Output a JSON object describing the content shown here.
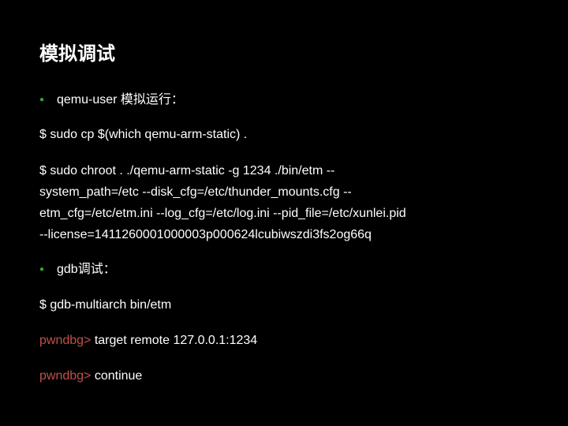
{
  "title": "模拟调试",
  "bullet1": "qemu-user 模拟运行：",
  "line1_prompt": "$",
  "line1_cmd": " sudo cp $(which qemu-arm-static) .",
  "line2_prompt": "$",
  "line2_cmd_a": " sudo chroot . ./qemu-arm-static -g 1234 ./bin/etm --",
  "line2_cmd_b": "system_path=/etc --disk_cfg=/etc/thunder_mounts.cfg --",
  "line2_cmd_c": "etm_cfg=/etc/etm.ini --log_cfg=/etc/log.ini --pid_file=/etc/xunlei.pid",
  "line2_cmd_d": "--license=1411260001000003p000624lcubiwszdi3fs2og66q",
  "bullet2": "gdb调试：",
  "line3_prompt": "$",
  "line3_cmd": " gdb-multiarch bin/etm",
  "line4_prompt": "pwndbg>",
  "line4_cmd": " target remote 127.0.0.1:1234",
  "line5_prompt": "pwndbg>",
  "line5_cmd": " continue"
}
